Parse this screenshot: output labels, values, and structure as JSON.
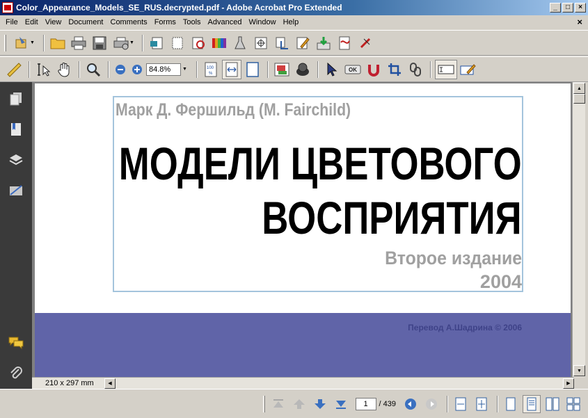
{
  "window": {
    "title": "Color_Appearance_Models_SE_RUS.decrypted.pdf - Adobe Acrobat Pro Extended",
    "minimize": "_",
    "maximize": "□",
    "close": "×"
  },
  "menu": {
    "items": [
      "File",
      "Edit",
      "View",
      "Document",
      "Comments",
      "Forms",
      "Tools",
      "Advanced",
      "Window",
      "Help"
    ],
    "close_doc": "×"
  },
  "toolbar2": {
    "zoom_value": "84.8%"
  },
  "document": {
    "author": "Марк  Д. Фершильд (M. Fairchild)",
    "title_line1": "МОДЕЛИ ЦВЕТОВОГО",
    "title_line2": "ВОСПРИЯТИЯ",
    "edition": "Второе издание",
    "year": "2004",
    "credit": "Перевод А.Шадрина    © 2006"
  },
  "colors": {
    "band": "#6064a8",
    "frame": "#a4c4dc",
    "nav_panel": "#3a3a3a"
  },
  "statusbar": {
    "page_size": "210 x 297 mm",
    "current_page": "1",
    "page_total": "/ 439"
  }
}
